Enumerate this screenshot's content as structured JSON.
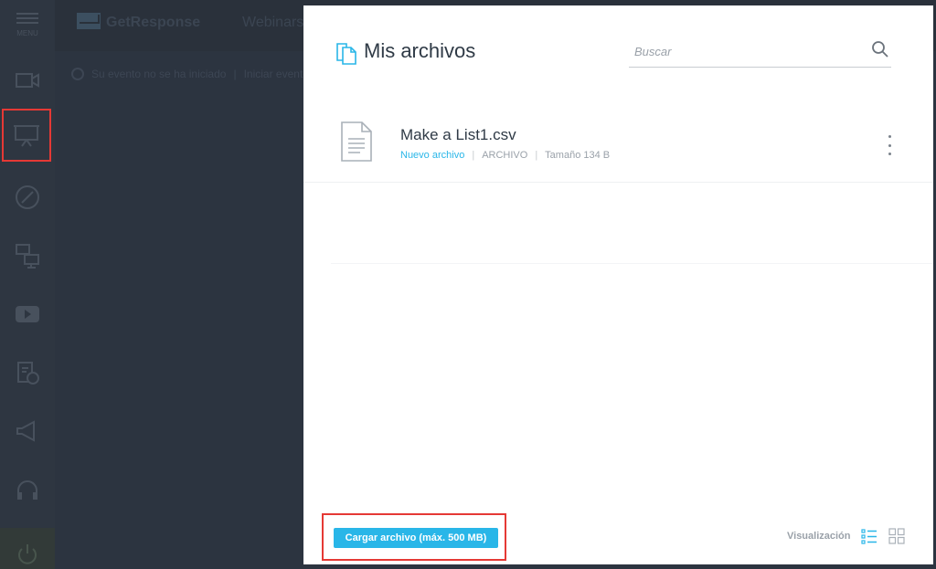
{
  "background": {
    "menu_label": "MENU",
    "brand": "GetResponse",
    "section": "Webinars",
    "event_status": "Su evento no se ha iniciado",
    "event_action": "Iniciar evento"
  },
  "modal": {
    "title": "Mis archivos",
    "search_placeholder": "Buscar",
    "files": [
      {
        "name": "Make a List1.csv",
        "status": "Nuevo archivo",
        "type": "ARCHIVO",
        "size": "Tamaño 134 B"
      }
    ],
    "upload_label": "Cargar archivo (máx. 500 MB)",
    "view_label": "Visualización"
  },
  "colors": {
    "accent": "#29b6e8",
    "highlight": "#e53935",
    "overlay_bg": "#2c3440"
  },
  "icons": [
    "video-icon",
    "presentation-icon",
    "pen-icon",
    "screen-share-icon",
    "youtube-icon",
    "survey-icon",
    "megaphone-icon",
    "headset-icon",
    "power-icon",
    "files-icon",
    "search-icon",
    "document-icon",
    "kebab-icon",
    "list-view-icon",
    "grid-view-icon"
  ]
}
